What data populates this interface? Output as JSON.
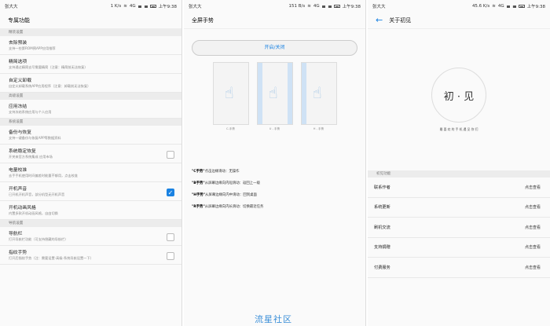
{
  "screen1": {
    "status": {
      "carrier": "张大大",
      "speed": "1 K/s",
      "network": "4G",
      "time": "上午9:38"
    },
    "title": "专属功能",
    "sections": [
      {
        "head": "精装设置",
        "items": [
          {
            "title": "去除预装",
            "desc": "支持一些第ROM预APP应用推荐",
            "checkbox": null
          },
          {
            "title": "精简选项",
            "desc": "支持通过精简去写需要精简（注意：精简前无法恢复）",
            "checkbox": null
          },
          {
            "title": "自定义卸载",
            "desc": "自定义卸载系统APP应用程序（注意：卸载前无法恢复）",
            "checkbox": null
          }
        ]
      },
      {
        "head": "高级设置",
        "items": [
          {
            "title": "应用冻结",
            "desc": "支持冻结系统应用与个人应用",
            "checkbox": null
          }
        ]
      },
      {
        "head": "系统设置",
        "items": [
          {
            "title": "备份与恢复",
            "desc": "支持一键备份与恢复APP等数据资料",
            "checkbox": null
          },
          {
            "title": "系统稳定恢复",
            "desc": "开关来官方系统集成 应用市场",
            "checkbox": false
          },
          {
            "title": "电量校准",
            "desc": "去手手机使用时间偏差时能量不够用，点击校准",
            "checkbox": null
          },
          {
            "title": "开机声音",
            "desc": "已开机开机声音，部分机型无开机声音",
            "checkbox": true
          },
          {
            "title": "开机动画风格",
            "desc": "内置多款开机动画风格，自由切换",
            "checkbox": null
          }
        ]
      },
      {
        "head": "导航设置",
        "items": [
          {
            "title": "导航栏",
            "desc": "打开导航栏功能（可支持隐藏的导航栏）",
            "checkbox": false
          },
          {
            "title": "指纹手势",
            "desc": "打开后指纹手势（注：需要设置-高级-系统导航设置一下）",
            "checkbox": false
          }
        ]
      }
    ]
  },
  "screen2": {
    "status": {
      "carrier": "张大大",
      "speed": "151 B/s",
      "network": "4G",
      "time": "上午9:38"
    },
    "title": "全屏手势",
    "toggle_label": "开启/关闭",
    "phones": [
      {
        "caption": "C-手势"
      },
      {
        "caption": "U - 手势"
      },
      {
        "caption": "H - 手势"
      }
    ],
    "gestures": [
      {
        "key": "\"C手势\"",
        "text": "点击边缘滑动：无操作"
      },
      {
        "key": "\"B手势\"",
        "text": "从屏幕边缘向内短滑动：返回上一级"
      },
      {
        "key": "\"H手势\"",
        "text": "从屏幕边缘向内中滑动：回到桌面"
      },
      {
        "key": "\"R手势\"",
        "text": "从屏幕边缘向内长滑动：切换最近任务"
      }
    ],
    "watermark": "流星社区"
  },
  "screen3": {
    "status": {
      "carrier": "张大大",
      "speed": "45.6 K/s",
      "network": "4G",
      "time": "上午9:38"
    },
    "title": "关于初见",
    "logo_text": "初 · 见",
    "slogan": "最 喜 欢 的 手 机 遇 见 你 们",
    "section_head": "初见功能",
    "rows": [
      {
        "label": "联系作者",
        "action": "点击查看"
      },
      {
        "label": "系统更新",
        "action": "点击查看"
      },
      {
        "label": "刷机交流",
        "action": "点击查看"
      },
      {
        "label": "支持捐赠",
        "action": "点击查看"
      },
      {
        "label": "付费服务",
        "action": "点击查看"
      }
    ]
  },
  "colors": {
    "accent": "#1a82e2",
    "section_bg": "#ececec"
  }
}
